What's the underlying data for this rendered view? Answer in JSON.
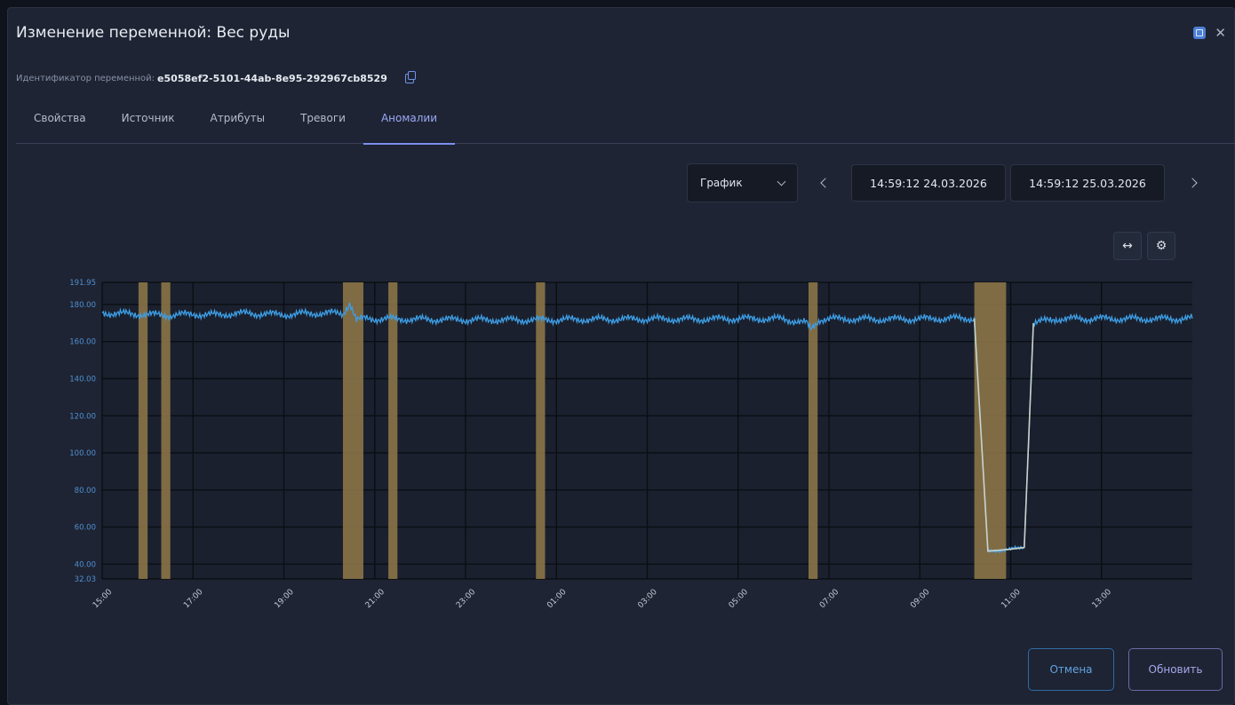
{
  "dialog": {
    "title": "Изменение переменной: Вес руды",
    "var_id_label": "Идентификатор переменной:",
    "var_id_value": "e5058ef2-5101-44ab-8e95-292967cb8529"
  },
  "tabs": [
    {
      "label": "Свойства"
    },
    {
      "label": "Источник"
    },
    {
      "label": "Атрибуты"
    },
    {
      "label": "Тревоги"
    },
    {
      "label": "Аномалии",
      "active": true
    }
  ],
  "toolbar": {
    "view_select": "График",
    "date_from": "14:59:12 24.03.2026",
    "date_to": "14:59:12 25.03.2026"
  },
  "buttons": {
    "cancel": "Отмена",
    "refresh": "Обновить"
  },
  "colors": {
    "series": "#3d9ee6",
    "anomaly": "#8b7447",
    "anomaly_series": "#c9d3cc",
    "accent": "#7d8ef0"
  },
  "chart_data": {
    "type": "line",
    "x_ticks": [
      "15:00",
      "17:00",
      "19:00",
      "21:00",
      "23:00",
      "01:00",
      "03:00",
      "05:00",
      "07:00",
      "09:00",
      "11:00",
      "13:00"
    ],
    "y_ticks": [
      "32.03",
      "40.00",
      "60.00",
      "80.00",
      "100.00",
      "120.00",
      "140.00",
      "160.00",
      "180.00",
      "191.95"
    ],
    "ylim": [
      32.03,
      191.95
    ],
    "x_range_hours": [
      0,
      24
    ],
    "series": [
      {
        "points": [
          [
            0.0,
            175.5
          ],
          [
            0.5,
            175.0
          ],
          [
            1.0,
            174.6
          ],
          [
            1.5,
            174.2
          ],
          [
            2.0,
            174.8
          ],
          [
            2.5,
            174.4
          ],
          [
            3.0,
            175.2
          ],
          [
            3.5,
            175.0
          ],
          [
            4.0,
            174.5
          ],
          [
            4.5,
            175.1
          ],
          [
            5.0,
            175.4
          ],
          [
            5.3,
            175.0
          ],
          [
            5.45,
            181.0
          ],
          [
            5.6,
            171.5
          ],
          [
            5.8,
            172.5
          ],
          [
            6.0,
            172.3
          ],
          [
            7.0,
            172.0
          ],
          [
            8.0,
            171.8
          ],
          [
            9.0,
            171.6
          ],
          [
            10.0,
            171.8
          ],
          [
            11.0,
            172.0
          ],
          [
            12.0,
            172.2
          ],
          [
            13.0,
            172.0
          ],
          [
            14.0,
            172.4
          ],
          [
            15.0,
            172.2
          ],
          [
            15.5,
            170.0
          ],
          [
            15.6,
            166.5
          ],
          [
            15.8,
            172.0
          ],
          [
            16.0,
            172.3
          ],
          [
            17.0,
            172.0
          ],
          [
            18.0,
            172.2
          ],
          [
            19.0,
            172.6
          ],
          [
            19.2,
            172.4
          ],
          [
            19.5,
            47.0
          ],
          [
            20.0,
            48.0
          ],
          [
            20.3,
            49.0
          ],
          [
            20.5,
            170.0
          ],
          [
            21.0,
            172.2
          ],
          [
            22.0,
            172.4
          ],
          [
            23.0,
            172.2
          ],
          [
            24.0,
            172.4
          ]
        ]
      }
    ],
    "anomaly_ranges_hours": [
      [
        0.8,
        1.0
      ],
      [
        1.3,
        1.5
      ],
      [
        5.3,
        5.75
      ],
      [
        6.3,
        6.5
      ],
      [
        9.55,
        9.75
      ],
      [
        15.55,
        15.75
      ],
      [
        19.2,
        19.9
      ]
    ],
    "grid": true
  }
}
